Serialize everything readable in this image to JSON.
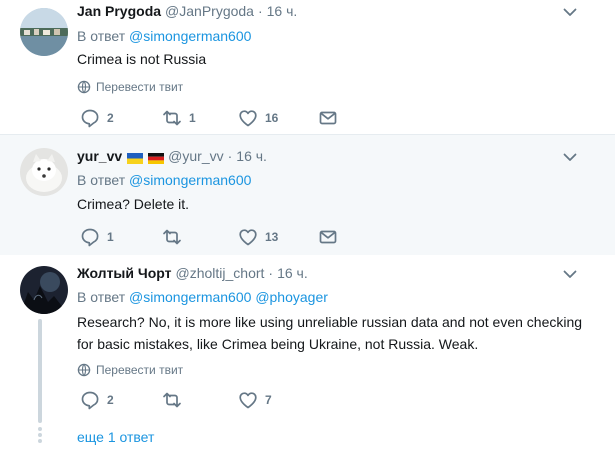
{
  "tweets": [
    {
      "name": "Jan Prygoda",
      "handle": "@JanPrygoda",
      "dot": "·",
      "time": "16 ч.",
      "reply_prefix": "В ответ",
      "reply_to": [
        "@simongerman600"
      ],
      "text": "Crimea is not Russia",
      "translate": "Перевести твит",
      "replies": "2",
      "retweets": "1",
      "likes": "16"
    },
    {
      "name": "yur_vv",
      "flags": [
        "ukraine-flag",
        "germany-flag"
      ],
      "handle": "@yur_vv",
      "dot": "·",
      "time": "16 ч.",
      "reply_prefix": "В ответ",
      "reply_to": [
        "@simongerman600"
      ],
      "text": "Crimea? Delete it.",
      "replies": "1",
      "retweets": "",
      "likes": "13"
    },
    {
      "name": "Жолтый Чорт",
      "handle": "@zholtij_chort",
      "dot": "·",
      "time": "16 ч.",
      "reply_prefix": "В ответ",
      "reply_to": [
        "@simongerman600",
        "@phoyager"
      ],
      "text_line1": "Research? No, it is more like using unreliable russian data and not even checking",
      "text_line2": "for basic mistakes, like Crimea being Ukraine, not Russia. Weak.",
      "translate": "Перевести твит",
      "replies": "2",
      "retweets": "",
      "likes": "7",
      "more_replies": "еще 1 ответ"
    }
  ],
  "colors": {
    "link": "#1b95e0",
    "muted": "#657786",
    "highlight_bg": "#f5f8fa",
    "thread_line": "#ccd6dd"
  },
  "icons": [
    "globe-icon",
    "reply-icon",
    "retweet-icon",
    "like-icon",
    "message-icon",
    "chevron-down-icon"
  ]
}
